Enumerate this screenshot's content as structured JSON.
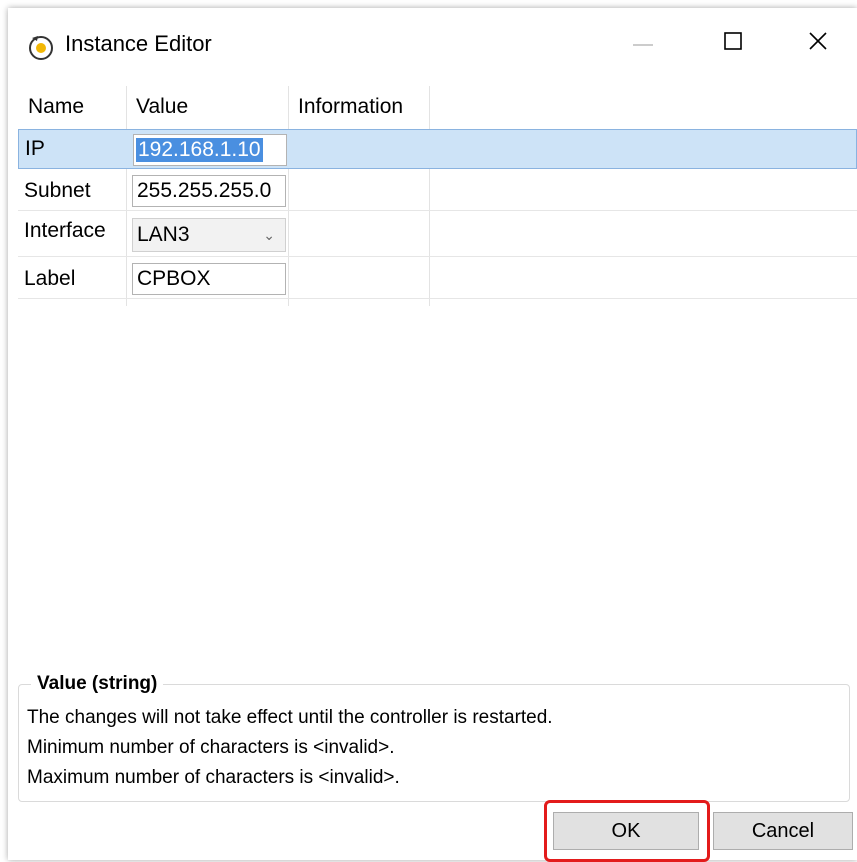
{
  "window": {
    "title": "Instance Editor",
    "controls": [
      "minimize-icon",
      "maximize-icon",
      "close-icon"
    ]
  },
  "grid": {
    "columns": [
      "Name",
      "Value",
      "Information"
    ],
    "rows": [
      {
        "name": "IP",
        "value": "192.168.1.10",
        "information": "",
        "selected": true
      },
      {
        "name": "Subnet",
        "value": "255.255.255.0",
        "information": ""
      },
      {
        "name": "Interface",
        "value": "LAN3",
        "information": "",
        "type": "dropdown"
      },
      {
        "name": "Label",
        "value": "CPBOX",
        "information": ""
      }
    ]
  },
  "info": {
    "title": "Value (string)",
    "lines": [
      "The changes will not take effect until the controller is restarted.",
      "Minimum number of characters is <invalid>.",
      "Maximum number of characters is <invalid>."
    ]
  },
  "buttons": {
    "ok": "OK",
    "cancel": "Cancel"
  },
  "colors": {
    "selection": "#cde3f7",
    "text_selection": "#4a8fe0",
    "highlight": "#e31b1b"
  }
}
